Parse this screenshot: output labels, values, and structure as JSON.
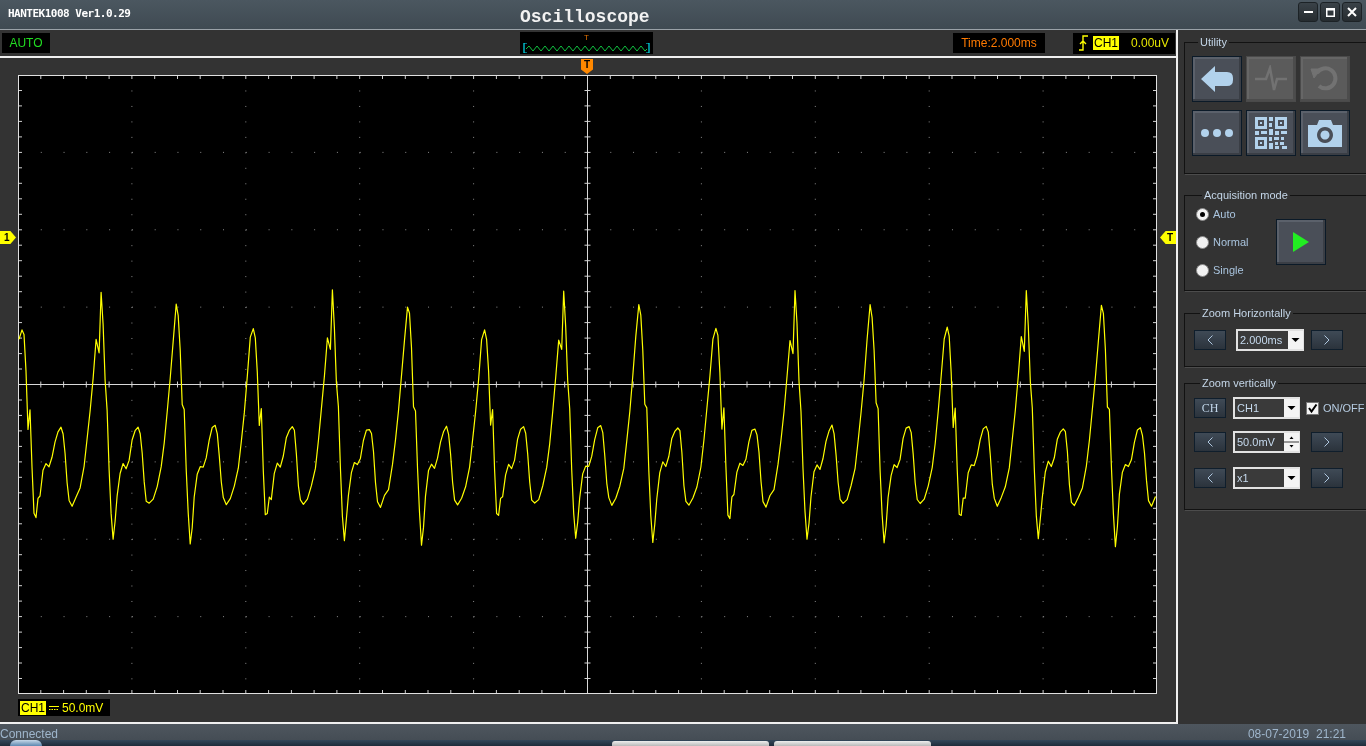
{
  "window": {
    "title": "HANTEK1008 Ver1.0.29",
    "heading": "Oscilloscope"
  },
  "scope": {
    "mode": "AUTO",
    "memory_marker": "T",
    "time_readout": "Time:2.000ms",
    "trigger": {
      "channel": "CH1",
      "level": "0.00uV"
    },
    "position_marker": "T",
    "channel_marker": "1",
    "level_marker": "T",
    "channel_label": {
      "channel": "CH1",
      "scale": "50.0mV"
    }
  },
  "utility": {
    "title": "Utility",
    "buttons": [
      {
        "kind": "back",
        "disabled": false
      },
      {
        "kind": "pulse",
        "disabled": true
      },
      {
        "kind": "undo",
        "disabled": true
      },
      {
        "kind": "more",
        "disabled": false
      },
      {
        "kind": "qr",
        "disabled": false
      },
      {
        "kind": "camera",
        "disabled": false
      }
    ]
  },
  "acquisition": {
    "title": "Acquisition mode",
    "options": [
      {
        "label": "Auto",
        "selected": true
      },
      {
        "label": "Normal",
        "selected": false
      },
      {
        "label": "Single",
        "selected": false
      }
    ]
  },
  "zoom_horizontal": {
    "title": "Zoom Horizontally",
    "timebase": "2.000ms"
  },
  "zoom_vertical": {
    "title": "Zoom vertically",
    "channel_button": "CH",
    "channel": "CH1",
    "display": {
      "label": "ON/OFF",
      "checked": true
    },
    "scale": "50.0mV",
    "probe": "x1"
  },
  "status_bar": {
    "status": "Connected",
    "datetime": "08-07-2019  21:21"
  }
}
